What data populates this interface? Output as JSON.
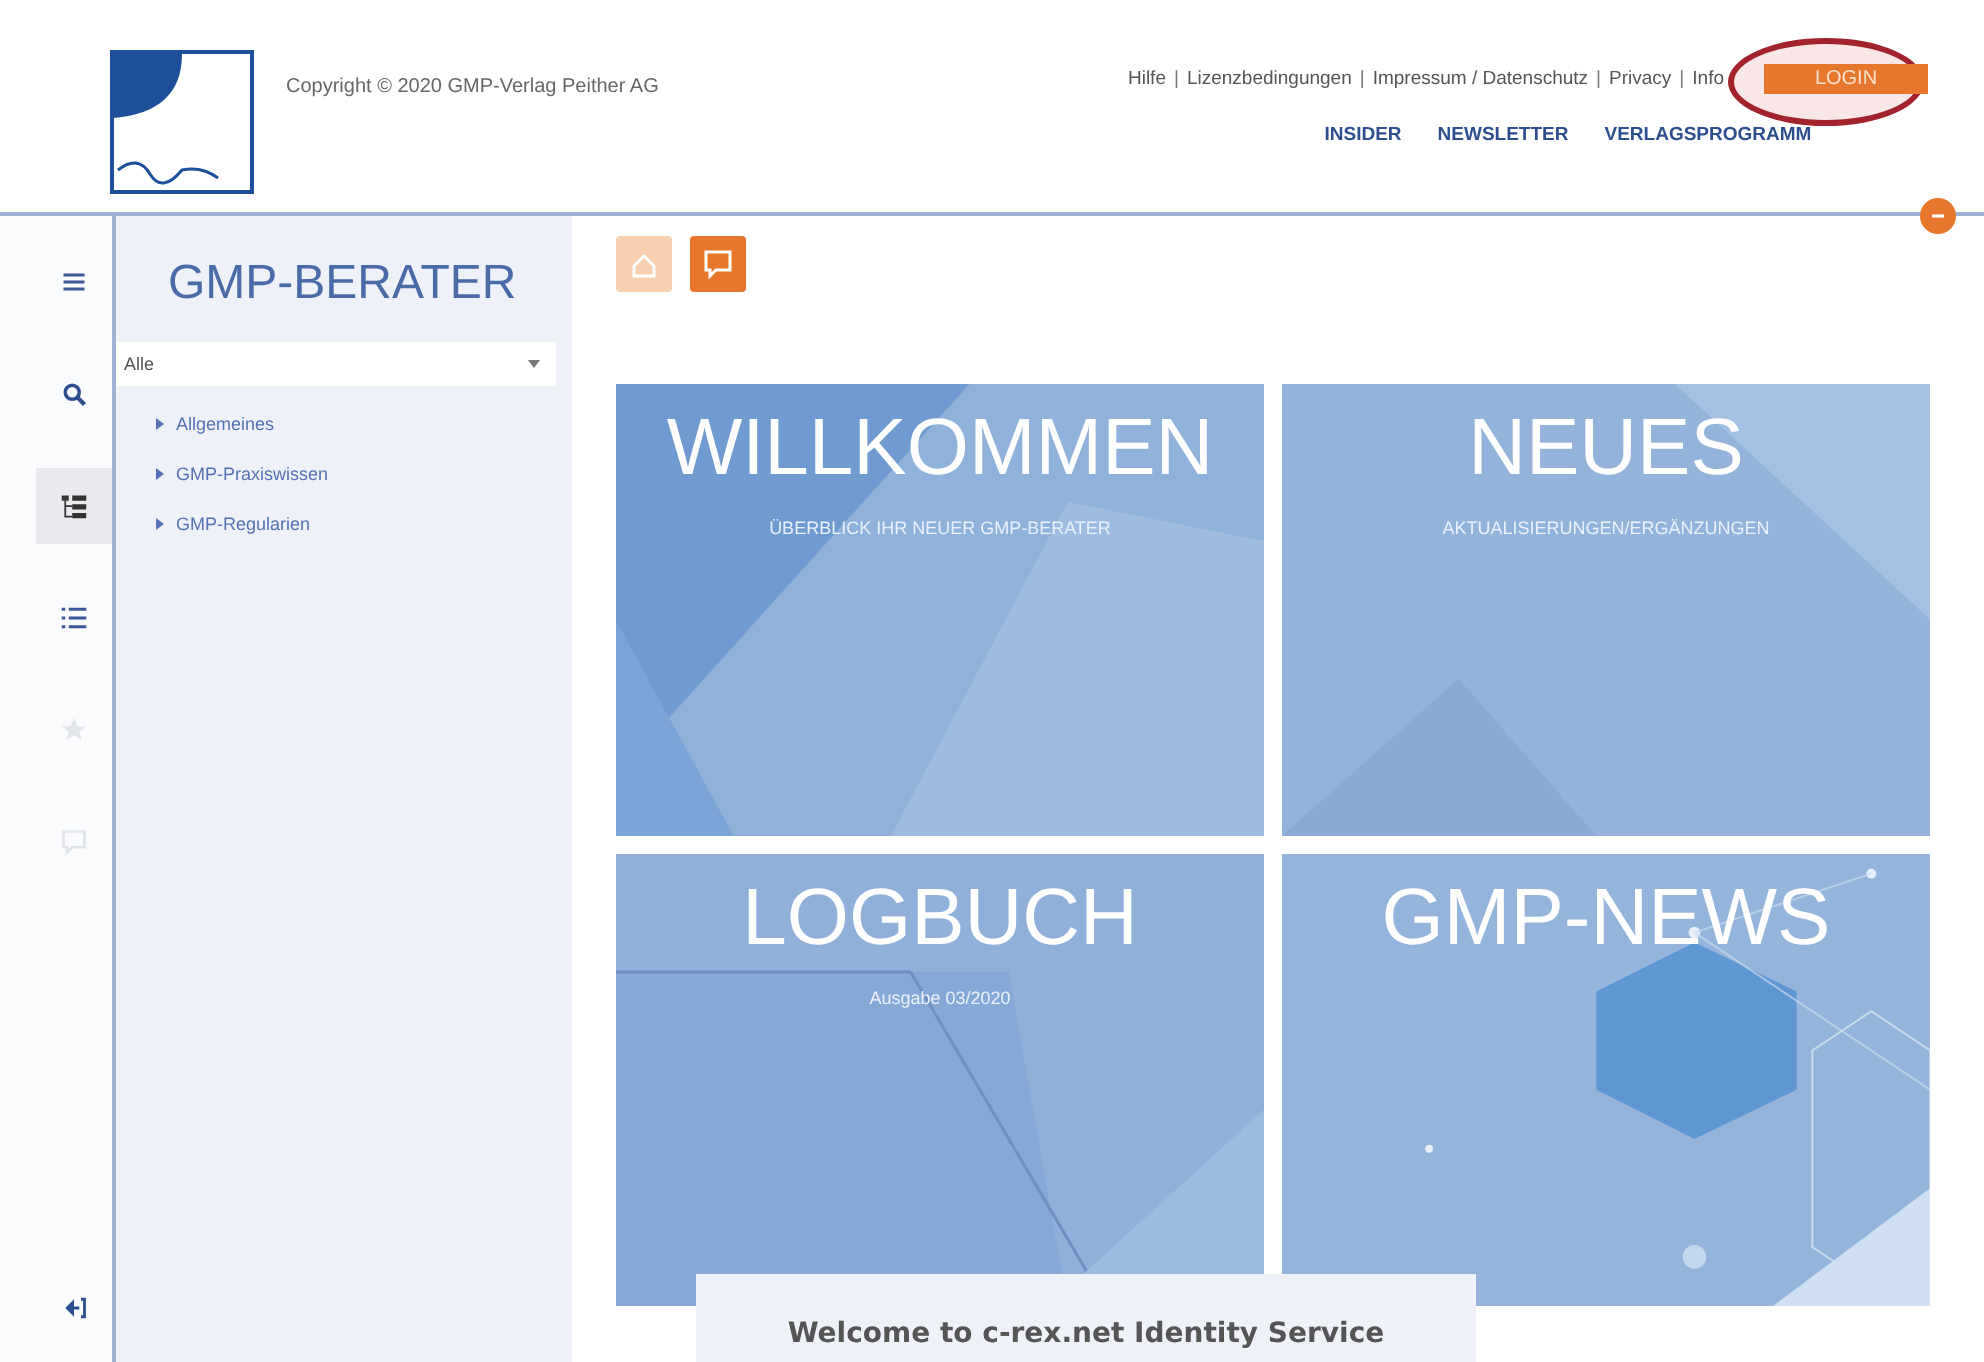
{
  "header": {
    "copyright": "Copyright © 2020 GMP-Verlag Peither AG",
    "links": [
      "Hilfe",
      "Lizenzbedingungen",
      "Impressum / Datenschutz",
      "Privacy",
      "Info"
    ],
    "separator": "|",
    "login": "LOGIN",
    "login_highlighted": true,
    "nav": [
      "INSIDER",
      "NEWSLETTER",
      "VERLAGSPROGRAMM"
    ]
  },
  "rail": [
    {
      "kind": "menu",
      "selected": false,
      "disabled": false
    },
    {
      "kind": "search",
      "selected": false,
      "disabled": false
    },
    {
      "kind": "tree",
      "selected": true,
      "disabled": false
    },
    {
      "kind": "list",
      "selected": false,
      "disabled": false
    },
    {
      "kind": "star",
      "selected": false,
      "disabled": true
    },
    {
      "kind": "comment",
      "selected": false,
      "disabled": true
    },
    {
      "kind": "login",
      "selected": false,
      "disabled": false
    }
  ],
  "sidebar": {
    "title": "GMP-BERATER",
    "filter": {
      "value": "Alle"
    },
    "items": [
      {
        "label": "Allgemeines",
        "expanded": false
      },
      {
        "label": "GMP-Praxiswissen",
        "expanded": false
      },
      {
        "label": "GMP-Regularien",
        "expanded": false
      }
    ]
  },
  "toolbar": [
    {
      "kind": "home",
      "disabled": true
    },
    {
      "kind": "comment",
      "disabled": false
    }
  ],
  "tiles": [
    {
      "title": "WILLKOMMEN",
      "subtitle": "ÜBERBLICK IHR NEUER GMP-BERATER",
      "kind": "picture"
    },
    {
      "title": "NEUES",
      "subtitle": "AKTUALISIERUNGEN/ERGÄNZUNGEN",
      "kind": "picture"
    },
    {
      "title": "LOGBUCH",
      "subtitle": "Ausgabe 03/2020",
      "kind": "picture"
    },
    {
      "title": "GMP-NEWS",
      "kind": "picture"
    }
  ],
  "popup": {
    "title": "Welcome to c-rex.net Identity Service"
  }
}
